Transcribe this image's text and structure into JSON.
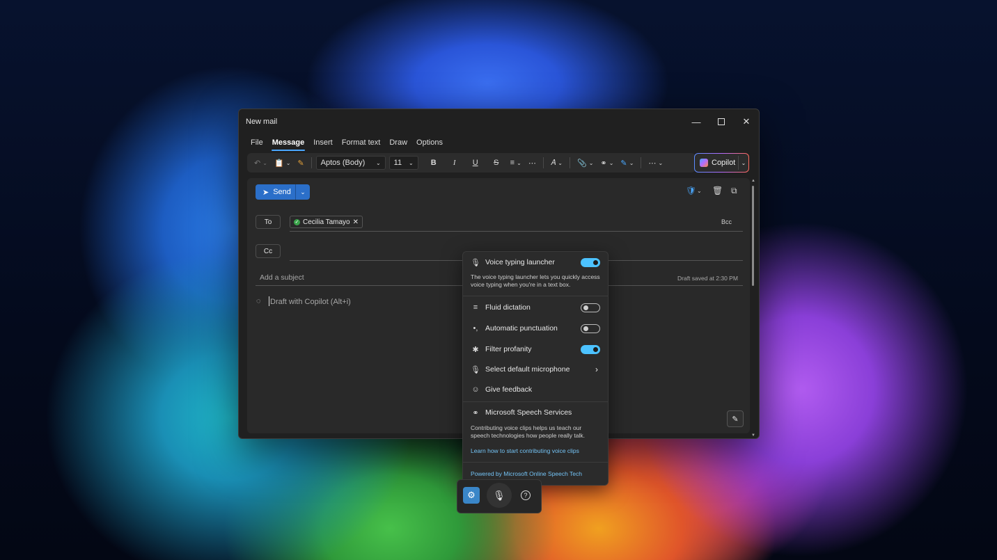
{
  "window": {
    "title": "New mail"
  },
  "menu": {
    "tabs": [
      "File",
      "Message",
      "Insert",
      "Format text",
      "Draw",
      "Options"
    ]
  },
  "ribbon": {
    "font_name": "Aptos (Body)",
    "font_size": "11",
    "copilot_label": "Copilot"
  },
  "compose": {
    "send_label": "Send",
    "to_label": "To",
    "cc_label": "Cc",
    "bcc_label": "Bcc",
    "recipient": "Cecilia Tamayo",
    "subject_placeholder": "Add a subject",
    "draft_status": "Draft saved at 2:30 PM",
    "body_placeholder": "Draft with Copilot (Alt+i)"
  },
  "voice_settings": {
    "launcher": {
      "label": "Voice typing launcher",
      "enabled": true,
      "description": "The voice typing launcher lets you quickly access voice typing when you're in a text box."
    },
    "fluid_dictation": {
      "label": "Fluid dictation",
      "enabled": false
    },
    "auto_punctuation": {
      "label": "Automatic punctuation",
      "enabled": false
    },
    "filter_profanity": {
      "label": "Filter profanity",
      "enabled": true
    },
    "microphone": {
      "label": "Select default microphone"
    },
    "feedback": {
      "label": "Give feedback"
    },
    "speech_services": {
      "title": "Microsoft Speech Services",
      "description": "Contributing voice clips helps us teach our speech technologies how people really talk.",
      "link": "Learn how to start contributing voice clips"
    },
    "powered_by": "Powered by Microsoft Online Speech Tech"
  },
  "colors": {
    "accent": "#2b6fc9",
    "toggle_on": "#4cc2ff",
    "link": "#74c3f5"
  },
  "icons": [
    "undo-icon",
    "paste-icon",
    "format-painter-icon",
    "bold-icon",
    "italic-icon",
    "underline-icon",
    "strikethrough-icon",
    "spacing-icon",
    "more-icon",
    "styles-icon",
    "attach-icon",
    "link-icon",
    "sensitivity-icon",
    "sparkle-icon",
    "shield-icon",
    "delete-icon",
    "popout-icon",
    "copilot-draft-icon",
    "mic-icon",
    "settings-icon",
    "help-icon"
  ]
}
